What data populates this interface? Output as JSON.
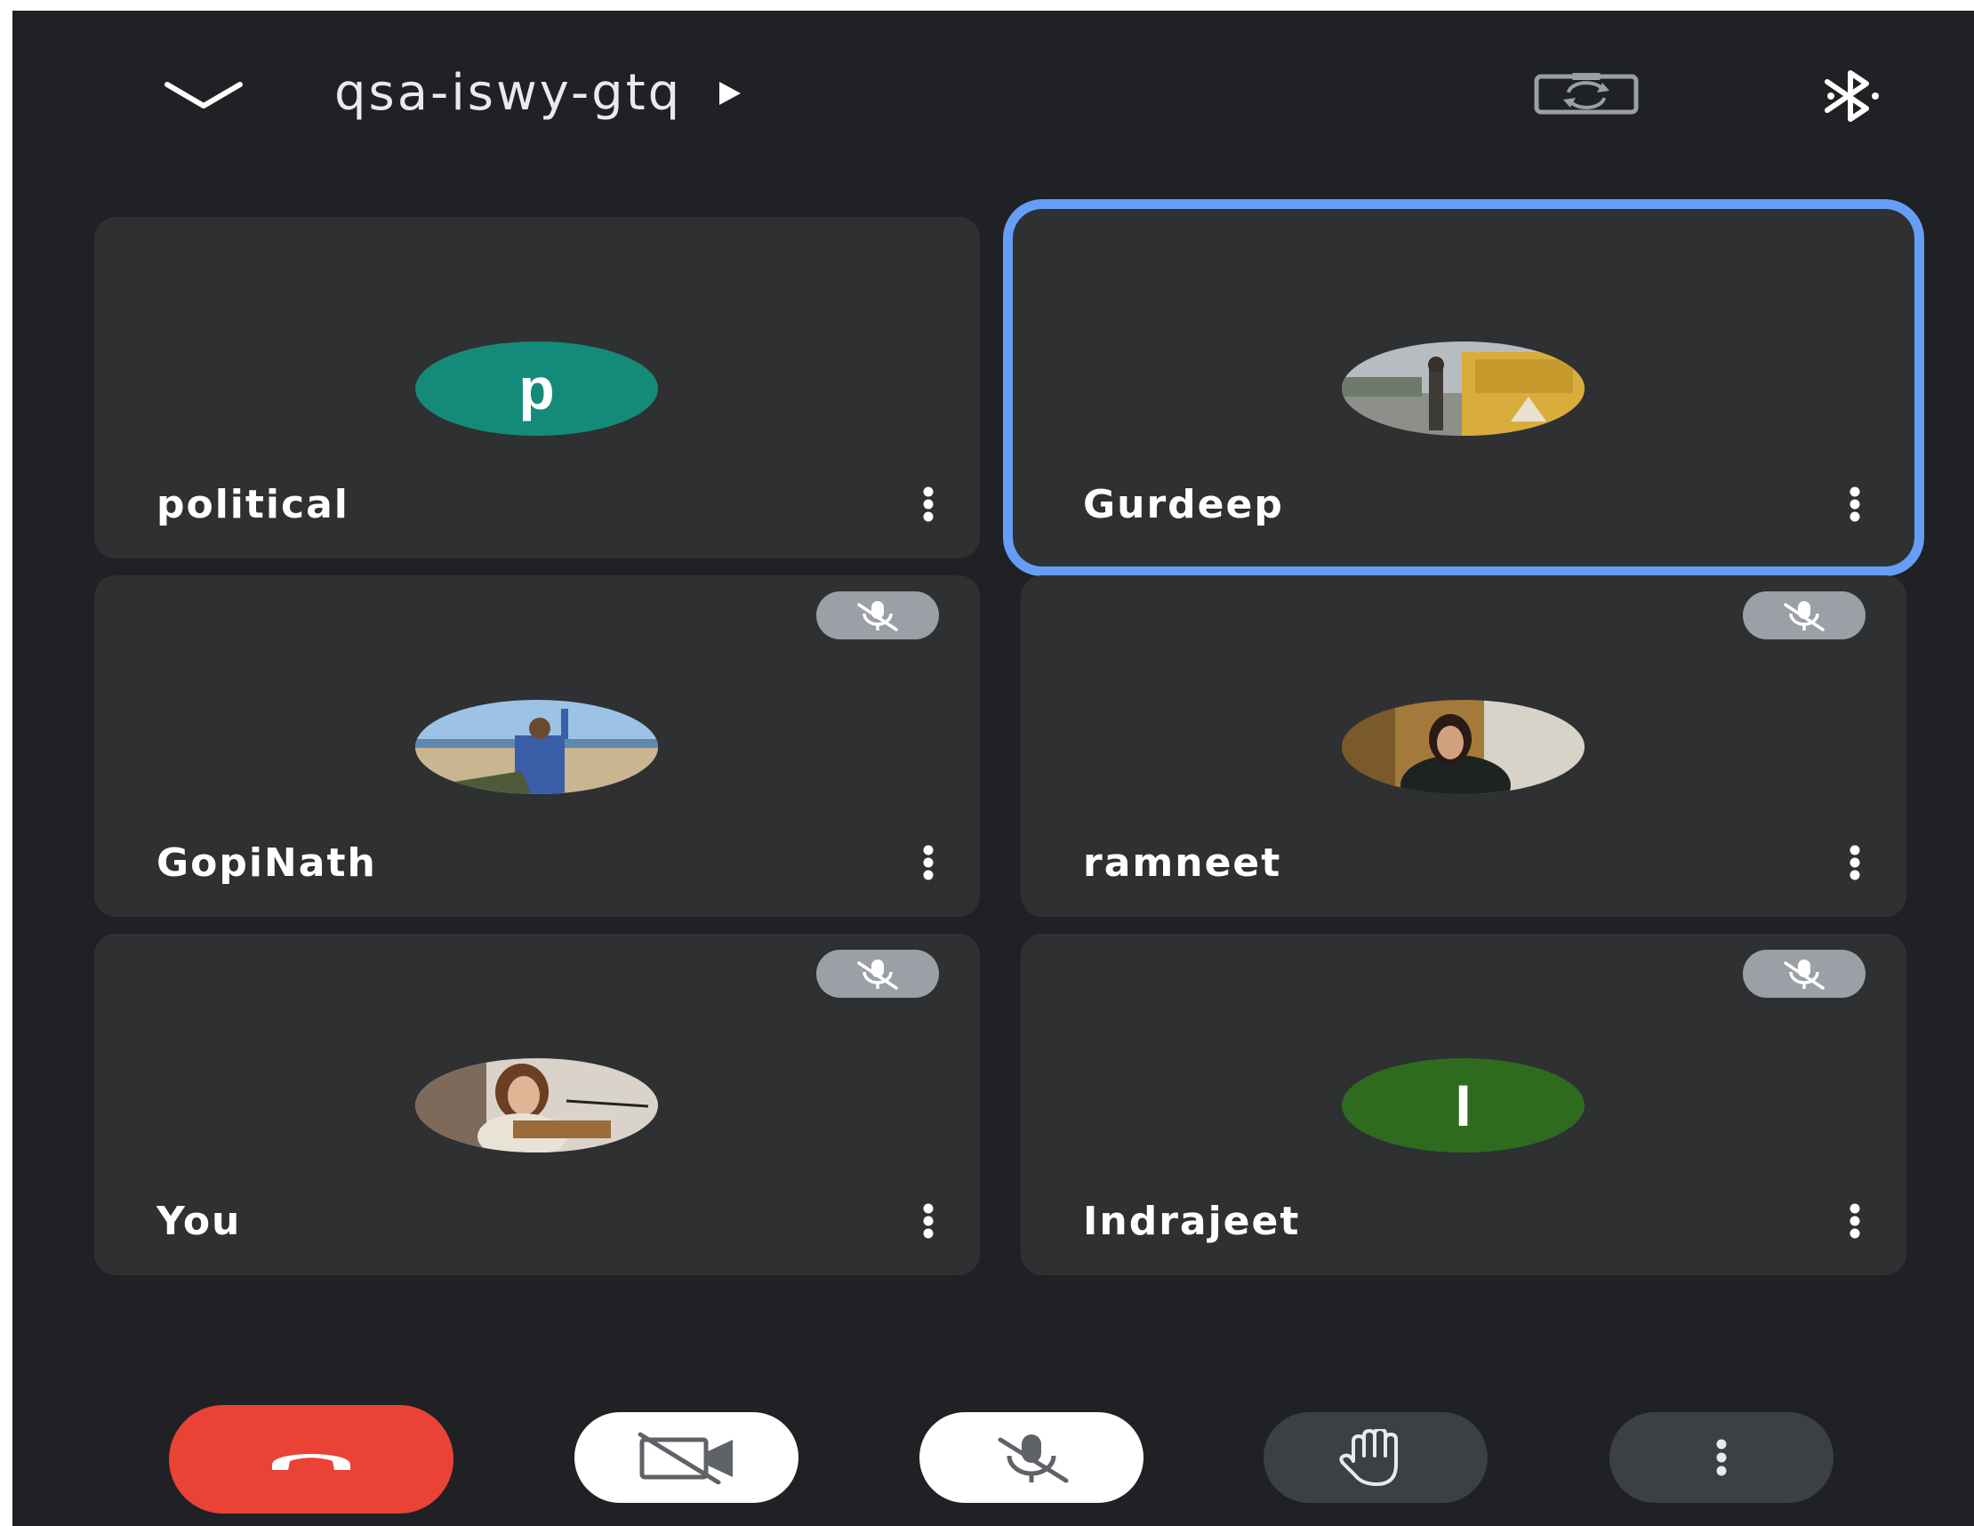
{
  "header": {
    "meeting_code": "qsa-iswy-gtq",
    "icons": {
      "collapse": "chevron-down-icon",
      "info": "play-arrow-icon",
      "switch_camera": "switch-camera-icon",
      "audio": "bluetooth-icon"
    }
  },
  "participants": [
    {
      "name": "political",
      "avatar_type": "letter",
      "avatar_letter": "p",
      "avatar_color": "#148b79",
      "muted": false,
      "active_speaker": false
    },
    {
      "name": "Gurdeep",
      "avatar_type": "photo",
      "muted": false,
      "active_speaker": true
    },
    {
      "name": "GopiNath",
      "avatar_type": "photo",
      "muted": true,
      "active_speaker": false
    },
    {
      "name": "ramneet",
      "avatar_type": "photo",
      "muted": true,
      "active_speaker": false
    },
    {
      "name": "You",
      "avatar_type": "photo",
      "muted": true,
      "active_speaker": false
    },
    {
      "name": "Indrajeet",
      "avatar_type": "letter",
      "avatar_letter": "I",
      "avatar_color": "#2e6b1f",
      "muted": true,
      "active_speaker": false
    }
  ],
  "controls": [
    {
      "name": "end-call",
      "icon": "phone-hangup-icon",
      "color": "#ea4335"
    },
    {
      "name": "camera-toggle",
      "icon": "videocam-off-icon",
      "state": "off"
    },
    {
      "name": "mic-toggle",
      "icon": "mic-off-icon",
      "state": "off"
    },
    {
      "name": "raise-hand",
      "icon": "hand-icon"
    },
    {
      "name": "more-options",
      "icon": "more-vert-icon"
    }
  ],
  "colors": {
    "background": "#202124",
    "tile": "#2f3032",
    "active_border": "#669df6",
    "end_call": "#ea4335",
    "mute_badge": "#9aa0a6"
  }
}
